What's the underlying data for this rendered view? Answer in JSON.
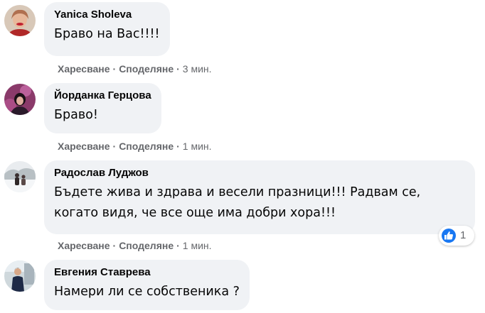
{
  "comments": [
    {
      "author": "Yanica Sholeva",
      "text": "Браво на Вас!!!!",
      "like": "Харесване",
      "share": "Споделяне",
      "time": "3 мин."
    },
    {
      "author": "Йорданка Герцова",
      "text": "Браво!",
      "like": "Харесване",
      "share": "Споделяне",
      "time": "1 мин."
    },
    {
      "author": "Радослав Луджов",
      "text": "Бъдете жива и здрава и весели празници!!! Радвам се, когато видя, че все още има добри хора!!!",
      "like": "Харесване",
      "share": "Споделяне",
      "time": "1 мин.",
      "reaction_count": "1",
      "reaction_icon": "thumbs-up-icon"
    },
    {
      "author": "Евгения Ставрева",
      "text": "Намери ли се собственика ?"
    }
  ],
  "separator": "·",
  "colors": {
    "bubble": "#f0f2f5",
    "meta": "#65676b",
    "like_blue": "#1877f2"
  }
}
